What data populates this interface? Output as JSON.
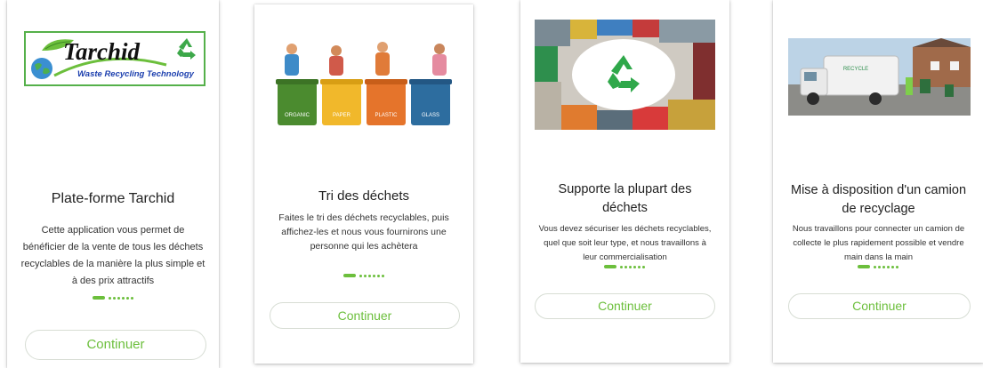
{
  "screens": [
    {
      "logo": {
        "name": "Tarchid",
        "tagline": "Waste Recycling Technology"
      },
      "title": "Plate-forme Tarchid",
      "description": "Cette application vous permet de bénéficier de la vente de tous les déchets recyclables de la manière la plus simple et à des prix attractifs",
      "button": "Continuer"
    },
    {
      "bins": [
        "ORGANIC",
        "PAPER",
        "PLASTIC",
        "GLASS"
      ],
      "title": "Tri des déchets",
      "description": "Faites le tri des déchets recyclables, puis affichez-les et nous vous fournirons une personne qui les achètera",
      "button": "Continuer"
    },
    {
      "title": "Supporte la plupart des déchets",
      "description": "Vous devez sécuriser les déchets recyclables, quel que soit leur type, et nous travaillons à leur commercialisation",
      "button": "Continuer"
    },
    {
      "truck_label": "RECYCLE",
      "title": "Mise à disposition d'un camion de recyclage",
      "description": "Nous travaillons pour connecter un camion de collecte le plus rapidement possible et vendre main dans la main",
      "button": "Continuer"
    }
  ],
  "colors": {
    "accent": "#6cbf3c",
    "button_border": "#d7ddd4"
  },
  "icons": [
    "recycle-icon",
    "globe-icon",
    "leaf-icon",
    "garbage-truck-icon"
  ]
}
